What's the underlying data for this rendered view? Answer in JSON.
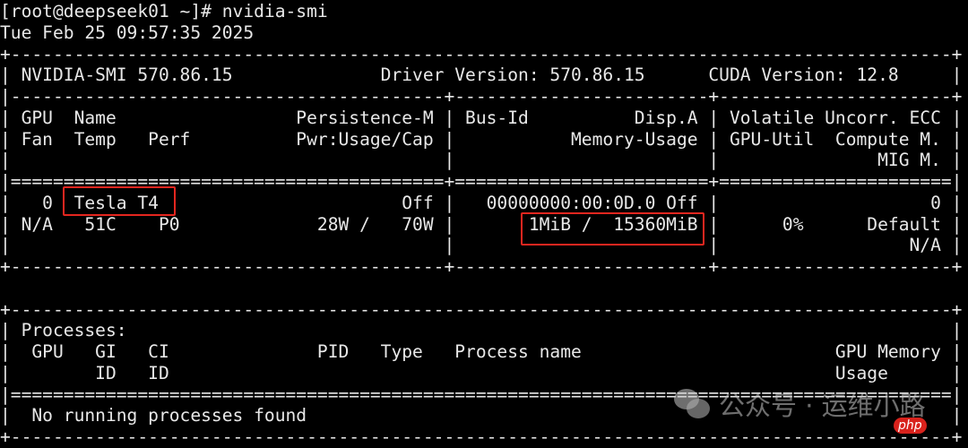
{
  "terminal": {
    "lines": [
      "[root@deepseek01 ~]# nvidia-smi",
      "Tue Feb 25 09:57:35 2025",
      "+-----------------------------------------------------------------------------------------+",
      "| NVIDIA-SMI 570.86.15              Driver Version: 570.86.15      CUDA Version: 12.8     |",
      "|-----------------------------------------+------------------------+----------------------+",
      "| GPU  Name                 Persistence-M | Bus-Id          Disp.A | Volatile Uncorr. ECC |",
      "| Fan  Temp   Perf          Pwr:Usage/Cap |           Memory-Usage | GPU-Util  Compute M. |",
      "|                                         |                        |               MIG M. |",
      "|=========================================+========================+======================|",
      "|   0  Tesla T4                       Off |   00000000:00:0D.0 Off |                    0 |",
      "| N/A   51C    P0             28W /   70W |       1MiB /  15360MiB |      0%      Default |",
      "|                                         |                        |                  N/A |",
      "+-----------------------------------------+------------------------+----------------------+",
      "",
      "+-----------------------------------------------------------------------------------------+",
      "| Processes:                                                                              |",
      "|  GPU   GI   CI              PID   Type   Process name                        GPU Memory |",
      "|        ID   ID                                                               Usage      |",
      "|=========================================================================================|",
      "|  No running processes found                                                             |",
      "+-----------------------------------------------------------------------------------------+"
    ]
  },
  "watermark": {
    "text": "公众号 · 运维小路",
    "badge": "php"
  },
  "colors": {
    "highlight": "#e5261f",
    "text": "#e8e8e8",
    "background": "#000000"
  }
}
